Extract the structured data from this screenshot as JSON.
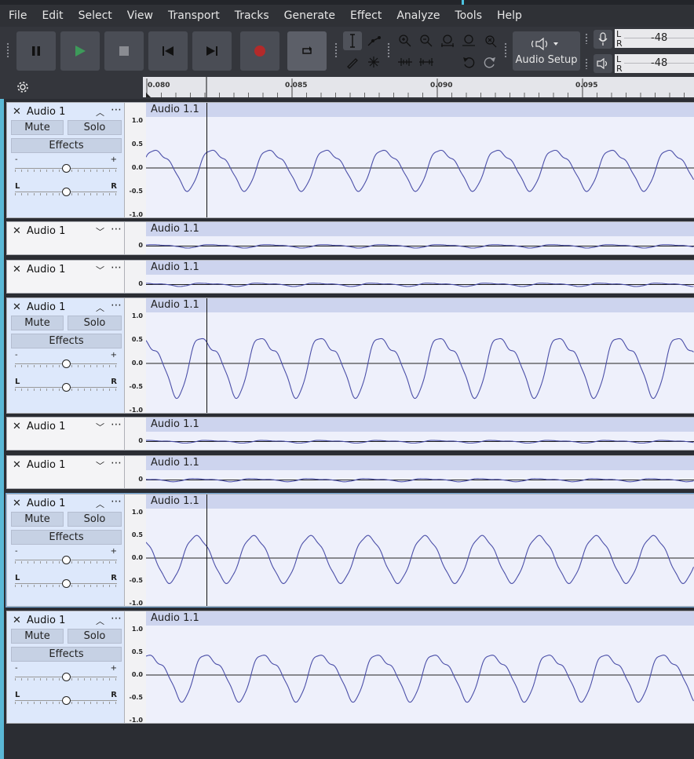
{
  "menu": [
    "File",
    "Edit",
    "Select",
    "View",
    "Transport",
    "Tracks",
    "Generate",
    "Effect",
    "Analyze",
    "Tools",
    "Help"
  ],
  "toolbar": {
    "audio_setup_label": "Audio Setup",
    "record_meter": {
      "value": "-48",
      "l": "L",
      "r": "R"
    },
    "playback_meter": {
      "value": "-48",
      "l": "L",
      "r": "R"
    },
    "record_color": "#b32a2a",
    "play_color": "#3d9a5a"
  },
  "timeline": {
    "ticks": [
      "0.080",
      "0.085",
      "0.090",
      "0.095"
    ]
  },
  "tracks": [
    {
      "name": "Audio 1",
      "clip": "Audio 1.1",
      "expanded": true,
      "mute": "Mute",
      "solo": "Solo",
      "effects": "Effects",
      "scale": [
        "1.0",
        "0.5",
        "0.0",
        "-0.5",
        "-1.0"
      ],
      "gain_minus": "-",
      "gain_plus": "+",
      "pan_left": "L",
      "pan_right": "R"
    },
    {
      "name": "Audio 1",
      "clip": "Audio 1.1",
      "expanded": false,
      "scale_zero": "0"
    },
    {
      "name": "Audio 1",
      "clip": "Audio 1.1",
      "expanded": false,
      "scale_zero": "0"
    },
    {
      "name": "Audio 1",
      "clip": "Audio 1.1",
      "expanded": true,
      "mute": "Mute",
      "solo": "Solo",
      "effects": "Effects",
      "scale": [
        "1.0",
        "0.5",
        "0.0",
        "-0.5",
        "-1.0"
      ],
      "gain_minus": "-",
      "gain_plus": "+",
      "pan_left": "L",
      "pan_right": "R"
    },
    {
      "name": "Audio 1",
      "clip": "Audio 1.1",
      "expanded": false,
      "scale_zero": "0"
    },
    {
      "name": "Audio 1",
      "clip": "Audio 1.1",
      "expanded": false,
      "scale_zero": "0"
    },
    {
      "name": "Audio 1",
      "clip": "Audio 1.1",
      "expanded": true,
      "selected": true,
      "mute": "Mute",
      "solo": "Solo",
      "effects": "Effects",
      "scale": [
        "1.0",
        "0.5",
        "0.0",
        "-0.5",
        "-1.0"
      ],
      "gain_minus": "-",
      "gain_plus": "+",
      "pan_left": "L",
      "pan_right": "R"
    },
    {
      "name": "Audio 1",
      "clip": "Audio 1.1",
      "expanded": true,
      "mute": "Mute",
      "solo": "Solo",
      "effects": "Effects",
      "scale": [
        "1.0",
        "0.5",
        "0.0",
        "-0.5",
        "-1.0"
      ],
      "gain_minus": "-",
      "gain_plus": "+",
      "pan_left": "L",
      "pan_right": "R"
    }
  ],
  "icons": [
    "pause-icon",
    "play-icon",
    "stop-icon",
    "skip-start-icon",
    "skip-end-icon",
    "record-icon",
    "loop-icon",
    "selection-tool-icon",
    "envelope-tool-icon",
    "draw-tool-icon",
    "multi-tool-icon",
    "zoom-in-icon",
    "zoom-out-icon",
    "fit-selection-icon",
    "fit-project-icon",
    "zoom-toggle-icon",
    "trim-icon",
    "silence-icon",
    "undo-icon",
    "redo-icon",
    "speaker-icon",
    "microphone-icon",
    "gear-icon",
    "close-icon",
    "chevron-icon",
    "more-icon"
  ]
}
